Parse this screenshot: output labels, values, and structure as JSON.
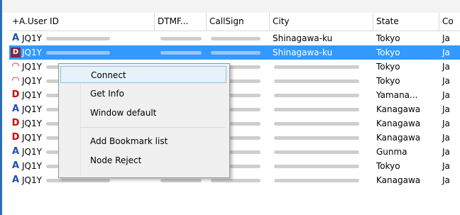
{
  "columns": [
    "+A.User ID",
    "DTMF...",
    "CallSign",
    "City",
    "State",
    "Co"
  ],
  "rows": [
    {
      "icon": "A",
      "icon_color": "#1e4fb0",
      "user_id": "JQ1Y",
      "city": "Shinagawa-ku",
      "state": "Tokyo",
      "country": "Ja"
    },
    {
      "icon": "D",
      "icon_color": "#b00000",
      "user_id": "JQ1Y",
      "city": "Shinagawa-ku",
      "state": "Tokyo",
      "country": "Ja",
      "selected": true
    },
    {
      "icon": "◠",
      "icon_color": "#e00000",
      "user_id": "JQ1Y",
      "city": "",
      "state": "Tokyo",
      "country": "Ja"
    },
    {
      "icon": "◠",
      "icon_color": "#e00000",
      "user_id": "JQ1Y",
      "city": "",
      "state": "Tokyo",
      "country": "Ja"
    },
    {
      "icon": "D",
      "icon_color": "#d00000",
      "user_id": "JQ1Y",
      "city": "",
      "state": "Yamana...",
      "country": "Ja"
    },
    {
      "icon": "A",
      "icon_color": "#1e4fb0",
      "user_id": "JQ1Y",
      "city": "",
      "state": "Kanagawa",
      "country": "Ja"
    },
    {
      "icon": "D",
      "icon_color": "#d00000",
      "user_id": "JQ1Y",
      "city": "",
      "state": "Kanagawa",
      "country": "Ja"
    },
    {
      "icon": "D",
      "icon_color": "#d00000",
      "user_id": "JQ1Y",
      "city": "",
      "state": "Kanagawa",
      "country": "Ja"
    },
    {
      "icon": "A",
      "icon_color": "#1e4fb0",
      "user_id": "JQ1Y",
      "city": "",
      "state": "Gunma",
      "country": "Ja"
    },
    {
      "icon": "A",
      "icon_color": "#1e4fb0",
      "user_id": "JQ1Y",
      "city": "",
      "state": "Tokyo",
      "country": "Ja"
    },
    {
      "icon": "A",
      "icon_color": "#1e4fb0",
      "user_id": "JQ1Y",
      "city": "",
      "state": "Kanagawa",
      "country": "Ja"
    }
  ],
  "context_menu": {
    "items": [
      "Connect",
      "Get Info",
      "Window default",
      "Add Bookmark list",
      "Node Reject"
    ],
    "highlighted": "Connect"
  }
}
